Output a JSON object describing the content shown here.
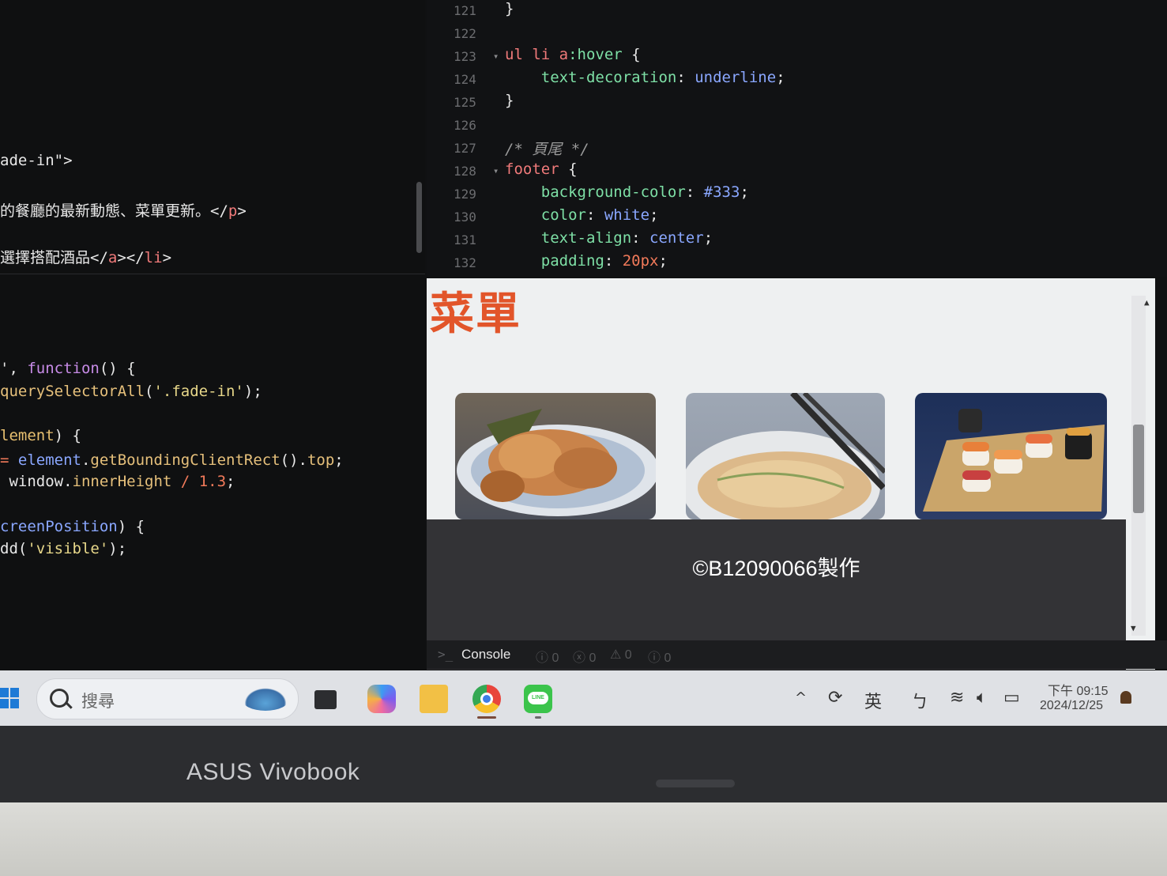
{
  "left_code": {
    "lines": [
      {
        "segs": [
          {
            "t": "ade-in\">",
            "c": ""
          }
        ]
      },
      {
        "segs": [
          {
            "t": "的餐廳的最新動態、菜單更新。</",
            "c": ""
          },
          {
            "t": "p",
            "c": "tag"
          },
          {
            "t": ">",
            "c": ""
          }
        ]
      },
      {
        "segs": [
          {
            "t": "選擇搭配酒品</",
            "c": ""
          },
          {
            "t": "a",
            "c": "tag"
          },
          {
            "t": "></",
            "c": ""
          },
          {
            "t": "li",
            "c": "tag"
          },
          {
            "t": ">",
            "c": ""
          }
        ]
      },
      {
        "segs": [
          {
            "t": "', ",
            "c": ""
          },
          {
            "t": "function",
            "c": "kw"
          },
          {
            "t": "() {",
            "c": ""
          }
        ]
      },
      {
        "segs": [
          {
            "t": "querySelectorAll",
            "c": "fn"
          },
          {
            "t": "(",
            "c": ""
          },
          {
            "t": "'.fade-in'",
            "c": "str"
          },
          {
            "t": ");",
            "c": ""
          }
        ]
      },
      {
        "segs": [
          {
            "t": "lement",
            "c": "var"
          },
          {
            "t": ") {",
            "c": ""
          }
        ]
      },
      {
        "segs": [
          {
            "t": "= ",
            "c": "num"
          },
          {
            "t": "element",
            "c": "v"
          },
          {
            "t": ".",
            "c": ""
          },
          {
            "t": "getBoundingClientRect",
            "c": "fn"
          },
          {
            "t": "().",
            "c": ""
          },
          {
            "t": "top",
            "c": "fn"
          },
          {
            "t": ";",
            "c": ""
          }
        ]
      },
      {
        "segs": [
          {
            "t": " window.",
            "c": ""
          },
          {
            "t": "innerHeight",
            "c": "fn"
          },
          {
            "t": " / ",
            "c": "num"
          },
          {
            "t": "1.3",
            "c": "num"
          },
          {
            "t": ";",
            "c": ""
          }
        ]
      },
      {
        "segs": [
          {
            "t": "creenPosition",
            "c": "v"
          },
          {
            "t": ") {",
            "c": ""
          }
        ]
      },
      {
        "segs": [
          {
            "t": "dd(",
            "c": ""
          },
          {
            "t": "'visible'",
            "c": "str"
          },
          {
            "t": ");",
            "c": ""
          }
        ]
      }
    ]
  },
  "right_code": {
    "lines": [
      {
        "n": "121",
        "fold": "",
        "segs": [
          {
            "t": "}",
            "c": ""
          }
        ]
      },
      {
        "n": "122",
        "fold": "",
        "segs": []
      },
      {
        "n": "123",
        "fold": "▾",
        "segs": [
          {
            "t": "ul li a",
            "c": "sel"
          },
          {
            "t": ":hover",
            "c": "p"
          },
          {
            "t": " {",
            "c": ""
          }
        ]
      },
      {
        "n": "124",
        "fold": "",
        "segs": [
          {
            "t": "    text-decoration",
            "c": "p"
          },
          {
            "t": ": ",
            "c": ""
          },
          {
            "t": "underline",
            "c": "v"
          },
          {
            "t": ";",
            "c": ""
          }
        ]
      },
      {
        "n": "125",
        "fold": "",
        "segs": [
          {
            "t": "}",
            "c": ""
          }
        ]
      },
      {
        "n": "126",
        "fold": "",
        "segs": []
      },
      {
        "n": "127",
        "fold": "",
        "segs": [
          {
            "t": "/* 頁尾 */",
            "c": "com"
          }
        ]
      },
      {
        "n": "128",
        "fold": "▾",
        "segs": [
          {
            "t": "footer",
            "c": "sel"
          },
          {
            "t": " {",
            "c": ""
          }
        ]
      },
      {
        "n": "129",
        "fold": "",
        "segs": [
          {
            "t": "    background-color",
            "c": "p"
          },
          {
            "t": ": ",
            "c": ""
          },
          {
            "t": "#333",
            "c": "hex"
          },
          {
            "t": ";",
            "c": ""
          }
        ]
      },
      {
        "n": "130",
        "fold": "",
        "segs": [
          {
            "t": "    color",
            "c": "p"
          },
          {
            "t": ": ",
            "c": ""
          },
          {
            "t": "white",
            "c": "v"
          },
          {
            "t": ";",
            "c": ""
          }
        ]
      },
      {
        "n": "131",
        "fold": "",
        "segs": [
          {
            "t": "    text-align",
            "c": "p"
          },
          {
            "t": ": ",
            "c": ""
          },
          {
            "t": "center",
            "c": "v"
          },
          {
            "t": ";",
            "c": ""
          }
        ]
      },
      {
        "n": "132",
        "fold": "",
        "segs": [
          {
            "t": "    padding",
            "c": "p"
          },
          {
            "t": ": ",
            "c": ""
          },
          {
            "t": "20px",
            "c": "num"
          },
          {
            "t": ";",
            "c": ""
          }
        ]
      }
    ]
  },
  "preview": {
    "title": "菜單",
    "footer_text": "©B12090066製作",
    "images": [
      {
        "name": "tonkatsu-image",
        "desc_icon": "food-photo"
      },
      {
        "name": "scallion-pancake-image",
        "desc_icon": "food-photo"
      },
      {
        "name": "sushi-image",
        "desc_icon": "food-photo"
      }
    ]
  },
  "console": {
    "prompt": ">_",
    "label": "Console",
    "counts": [
      "ⓘ 0",
      "ⓧ 0",
      "⚠ 0",
      "ⓘ 0"
    ]
  },
  "taskbar": {
    "search_placeholder": "搜尋",
    "ime_label": "英",
    "clock_time": "下午 09:15",
    "clock_date": "2024/12/25"
  },
  "laptop": {
    "brand": "ASUS Vivobook"
  },
  "colors": {
    "menu_title": "#e2552a",
    "footer_bg": "#333336",
    "accent": "#1e7ad6"
  }
}
